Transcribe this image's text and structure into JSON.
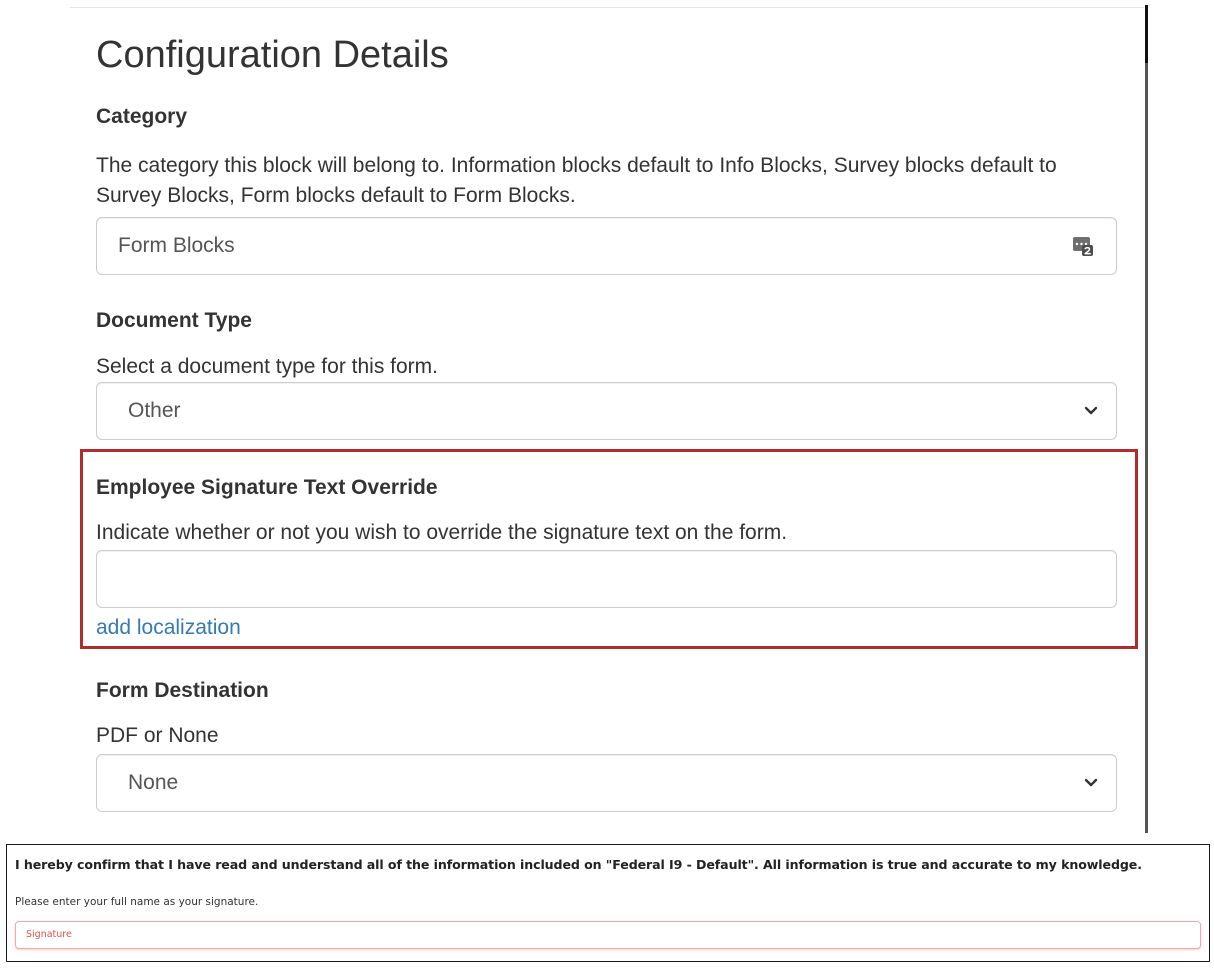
{
  "config": {
    "title": "Configuration Details",
    "category": {
      "label": "Category",
      "help": "The category this block will belong to. Information blocks default to Info Blocks, Survey blocks default to Survey Blocks, Form blocks default to Form Blocks.",
      "value": "Form Blocks",
      "icon": "category-picker-icon"
    },
    "document_type": {
      "label": "Document Type",
      "help": "Select a document type for this form.",
      "value": "Other"
    },
    "signature_override": {
      "label": "Employee Signature Text Override",
      "help": "Indicate whether or not you wish to override the signature text on the form.",
      "value": "",
      "link": "add localization",
      "highlight_color": "#b12c2c"
    },
    "form_destination": {
      "label": "Form Destination",
      "help": "PDF or None",
      "value": "None"
    }
  },
  "preview": {
    "confirmation": "I hereby confirm that I have read and understand all of the information included on \"Federal I9 - Default\". All information is true and accurate to my knowledge.",
    "instruction": "Please enter your full name as your signature.",
    "signature_placeholder": "Signature",
    "error_color": "#d9534f"
  },
  "colors": {
    "link": "#337ab7",
    "text": "#333333"
  }
}
